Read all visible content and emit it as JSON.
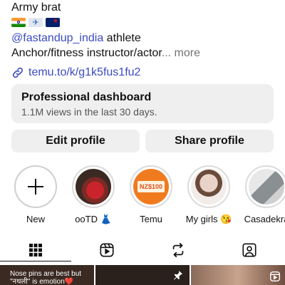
{
  "bio": {
    "name_line": "Army brat",
    "flags": [
      "india-flag",
      "airplane-icon",
      "new-zealand-flag"
    ],
    "handle": "@fastandup_india",
    "handle_suffix": " athlete",
    "description": "Anchor/fitness instructor/actor",
    "more": "... more",
    "link": "temu.to/k/g1k5fus1fu2"
  },
  "dashboard": {
    "title": "Professional dashboard",
    "subtitle": "1.1M views in the last 30 days."
  },
  "buttons": {
    "edit": "Edit profile",
    "share": "Share profile"
  },
  "stories": [
    {
      "label": "New",
      "type": "new"
    },
    {
      "label": "ooTD 👗",
      "type": "photo",
      "color": "#c9242b"
    },
    {
      "label": "Temu",
      "type": "promo",
      "color": "#f07b1f",
      "promo_text": "NZ$100"
    },
    {
      "label": "My girls 😘",
      "type": "photo",
      "color": "#d8c5bd"
    },
    {
      "label": "Casadekra",
      "type": "photo",
      "color": "#8a8f92"
    }
  ],
  "tabs": [
    "grid-icon",
    "reels-icon",
    "reposts-icon",
    "tagged-icon"
  ],
  "grid": {
    "post1_text_line1": "Nose pins are best  but",
    "post1_text_line2": "\"नथली\" is emotion❤️"
  },
  "colors": {
    "accent_link": "#3b4bc0",
    "muted": "#737373",
    "card_bg": "#efefef"
  }
}
